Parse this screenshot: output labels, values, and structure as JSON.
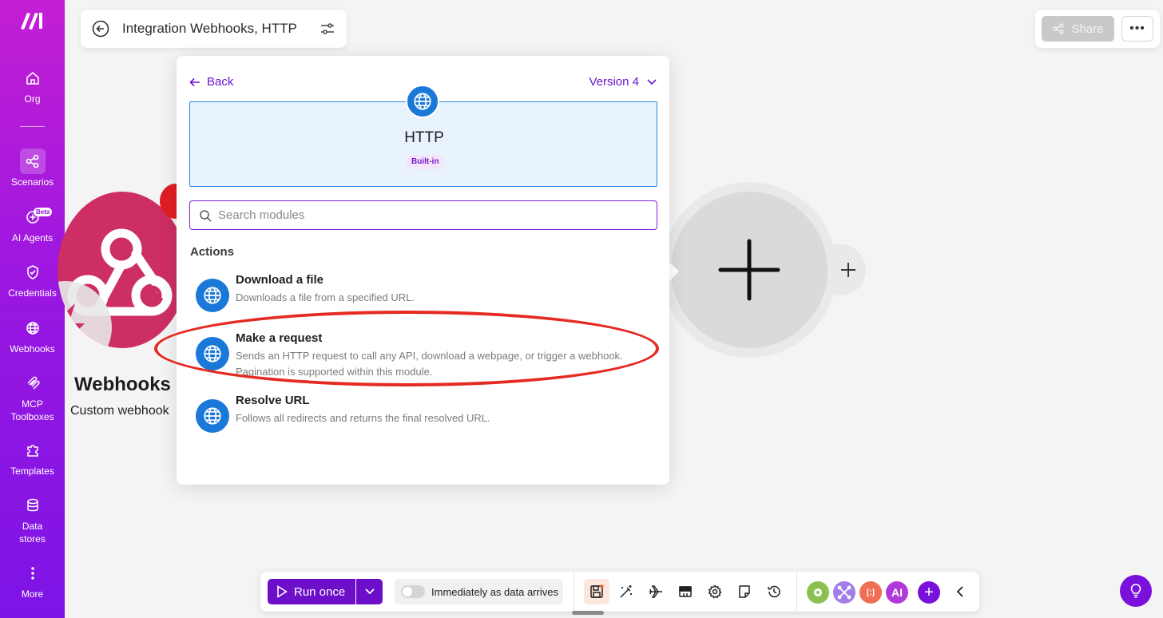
{
  "sidebar": {
    "logo_icon": "make-logo-icon",
    "items": [
      {
        "label": "Org",
        "icon": "home-icon"
      },
      {
        "label": "Scenarios",
        "icon": "share-nodes-icon",
        "active": true
      },
      {
        "label": "AI Agents",
        "icon": "sparkle-icon",
        "badge": "Beta"
      },
      {
        "label": "Credentials",
        "icon": "shield-check-icon"
      },
      {
        "label": "Webhooks",
        "icon": "globe-icon"
      },
      {
        "label": "MCP\nToolboxes",
        "icon": "mcp-icon"
      },
      {
        "label": "Templates",
        "icon": "puzzle-icon"
      },
      {
        "label": "Data\nstores",
        "icon": "database-icon"
      },
      {
        "label": "More",
        "icon": "more-vertical-icon"
      }
    ]
  },
  "header": {
    "title": "Integration Webhooks, HTTP",
    "share_label": "Share",
    "more_label": "•••"
  },
  "canvas": {
    "webhook_module": {
      "title": "Webhooks",
      "subtitle": "Custom webhook",
      "color": "#cd2e63"
    }
  },
  "popup": {
    "back_label": "Back",
    "version_label": "Version 4",
    "app": {
      "name": "HTTP",
      "badge": "Built-in",
      "color": "#1a78d8"
    },
    "search": {
      "placeholder": "Search modules",
      "value": ""
    },
    "section_title": "Actions",
    "actions": [
      {
        "name": "Download a file",
        "description": "Downloads a file from a specified URL."
      },
      {
        "name": "Make a request",
        "description": "Sends an HTTP request to call any API, download a webpage, or trigger a webhook. Pagination is supported within this module.",
        "highlighted": true
      },
      {
        "name": "Resolve URL",
        "description": "Follows all redirects and returns the final resolved URL."
      }
    ]
  },
  "toolbar": {
    "run_label": "Run once",
    "schedule_label": "Immediately as data arrives",
    "schedule_enabled": false,
    "tools": [
      "save-icon",
      "magic-wand-icon",
      "airplane-icon",
      "layout-icon",
      "settings-icon",
      "note-icon",
      "history-icon"
    ],
    "apps": [
      {
        "label": "",
        "color": "#8cc152",
        "icon": "tools-gear-icon"
      },
      {
        "label": "",
        "color": "#a17ee8",
        "icon": "flow-control-icon"
      },
      {
        "label": "[:]",
        "color": "#f06e55",
        "icon": "text-parser-icon"
      },
      {
        "label": "AI",
        "color": "#b03ad9",
        "icon": "ai-icon"
      },
      {
        "label": "+",
        "color": "#7a10dc",
        "icon": "add-icon"
      }
    ]
  },
  "colors": {
    "accent": "#6d0fc9",
    "highlight_ring": "#e52a22"
  }
}
